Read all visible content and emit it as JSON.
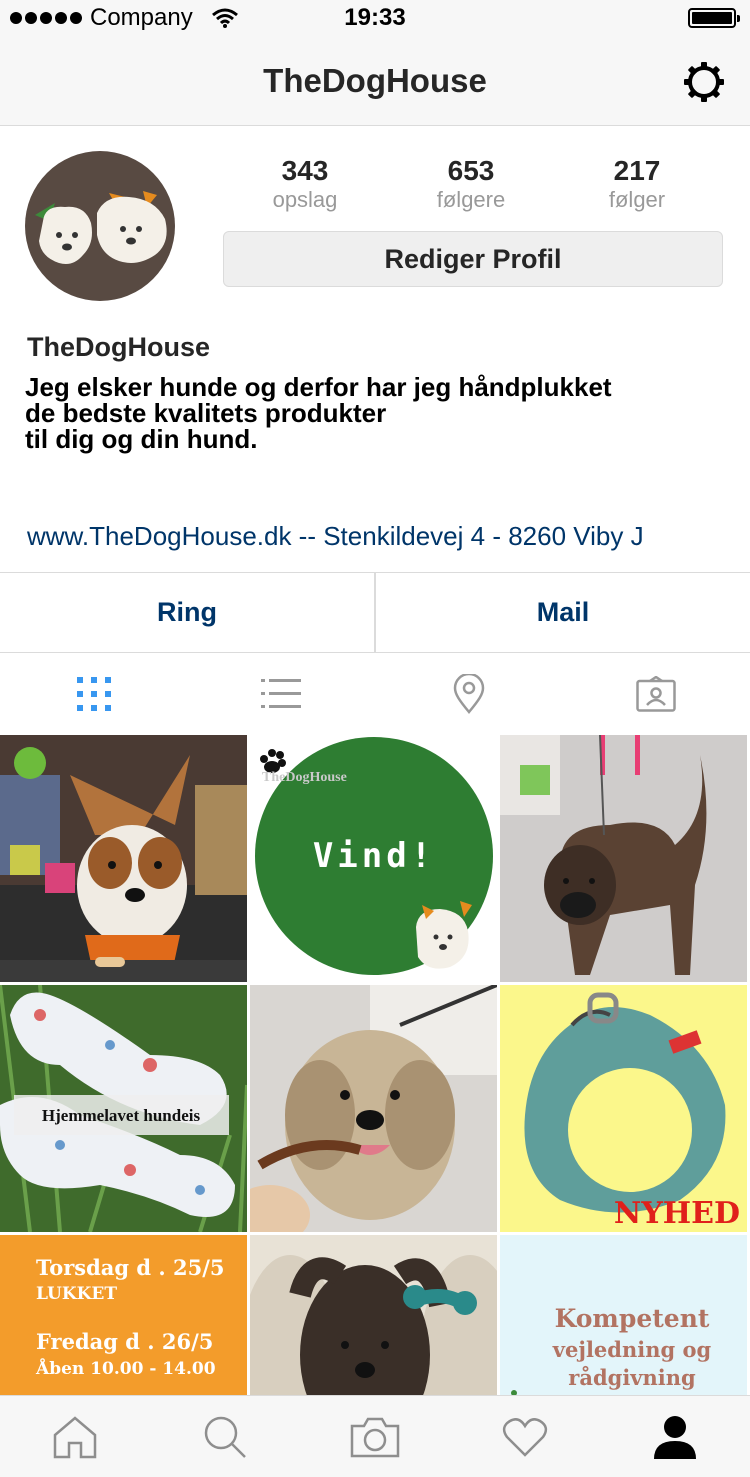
{
  "status_bar": {
    "carrier": "Company",
    "time": "19:33"
  },
  "nav": {
    "title": "TheDogHouse",
    "settings_icon": "gear-icon"
  },
  "profile": {
    "stats": [
      {
        "value": "343",
        "label": "opslag"
      },
      {
        "value": "653",
        "label": "følgere"
      },
      {
        "value": "217",
        "label": "følger"
      }
    ],
    "edit_button": "Rediger Profil",
    "username": "TheDogHouse",
    "bio": [
      "Jeg elsker hunde og derfor har jeg håndplukket",
      "de bedste kvalitets produkter",
      "til dig og din hund."
    ],
    "website": "www.TheDogHouse.dk -- Stenkildevej 4 - 8260 Viby J"
  },
  "contact": {
    "call": "Ring",
    "mail": "Mail"
  },
  "view_tabs": [
    "grid-icon",
    "list-icon",
    "location-pin-icon",
    "tagged-photos-icon"
  ],
  "posts": {
    "p2_logo": "TheDogHouse",
    "p2_text": "Vind!",
    "p4_caption": "Hjemmelavet hundeis",
    "p6_badge": "NYHED",
    "p7_lines": [
      "Torsdag d . 25/5",
      "LUKKET",
      "Fredag d . 26/5",
      "Åben 10.00 - 14.00"
    ],
    "p9_lines": [
      "Kompetent",
      "vejledning og",
      "rådgivning"
    ]
  },
  "tab_bar": [
    "home-icon",
    "search-icon",
    "camera-icon",
    "heart-icon",
    "profile-icon"
  ],
  "colors": {
    "link": "#003569",
    "grid_active": "#3897f0",
    "green": "#2e7d32",
    "orange": "#f39c2b",
    "yellow": "#fbf78b"
  }
}
